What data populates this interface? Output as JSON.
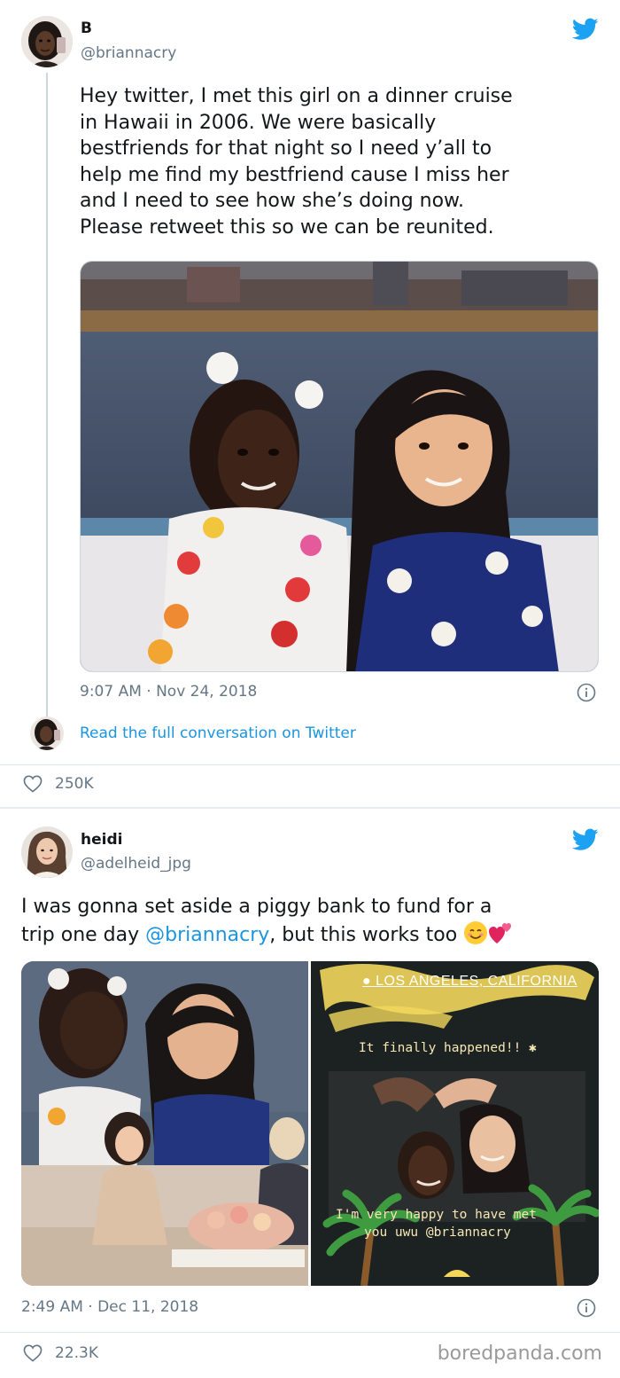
{
  "tweet1": {
    "name": "B",
    "handle": "@briannacry",
    "text_lines": [
      "Hey twitter, I met this girl on a dinner cruise",
      "in Hawaii in 2006. We were basically",
      "bestfriends for that night so I need y’all to",
      "help me find my bestfriend cause I miss her",
      "and I need to see how she’s doing now.",
      "Please retweet this so we can be reunited."
    ],
    "timestamp": "9:07 AM · Nov 24, 2018",
    "conversation_link": "Read the full conversation on Twitter",
    "likes": "250K",
    "icons": {
      "brand": "twitter-bird-icon",
      "info": "info-icon",
      "like": "heart-icon"
    },
    "colors": {
      "accent": "#1da1f2",
      "link": "#1b95e0",
      "muted": "#657786"
    }
  },
  "tweet2": {
    "name": "heidi",
    "handle": "@adelheid_jpg",
    "text_line1": "I was gonna set aside a piggy bank to fund for a",
    "text_line2_before": "trip one day ",
    "text_line2_mention": "@briannacry",
    "text_line2_after": ", but this works too ",
    "emoji": [
      "smiling-face-icon",
      "revolving-hearts-icon"
    ],
    "story": {
      "location": "LOS ANGELES, CALIFORNIA",
      "caption1": "It finally happened!! ✱",
      "caption2a": "I'm very happy to have met",
      "caption2b": "you uwu @briannacry"
    },
    "timestamp": "2:49 AM · Dec 11, 2018",
    "likes": "22.3K"
  },
  "watermark": "boredpanda.com"
}
